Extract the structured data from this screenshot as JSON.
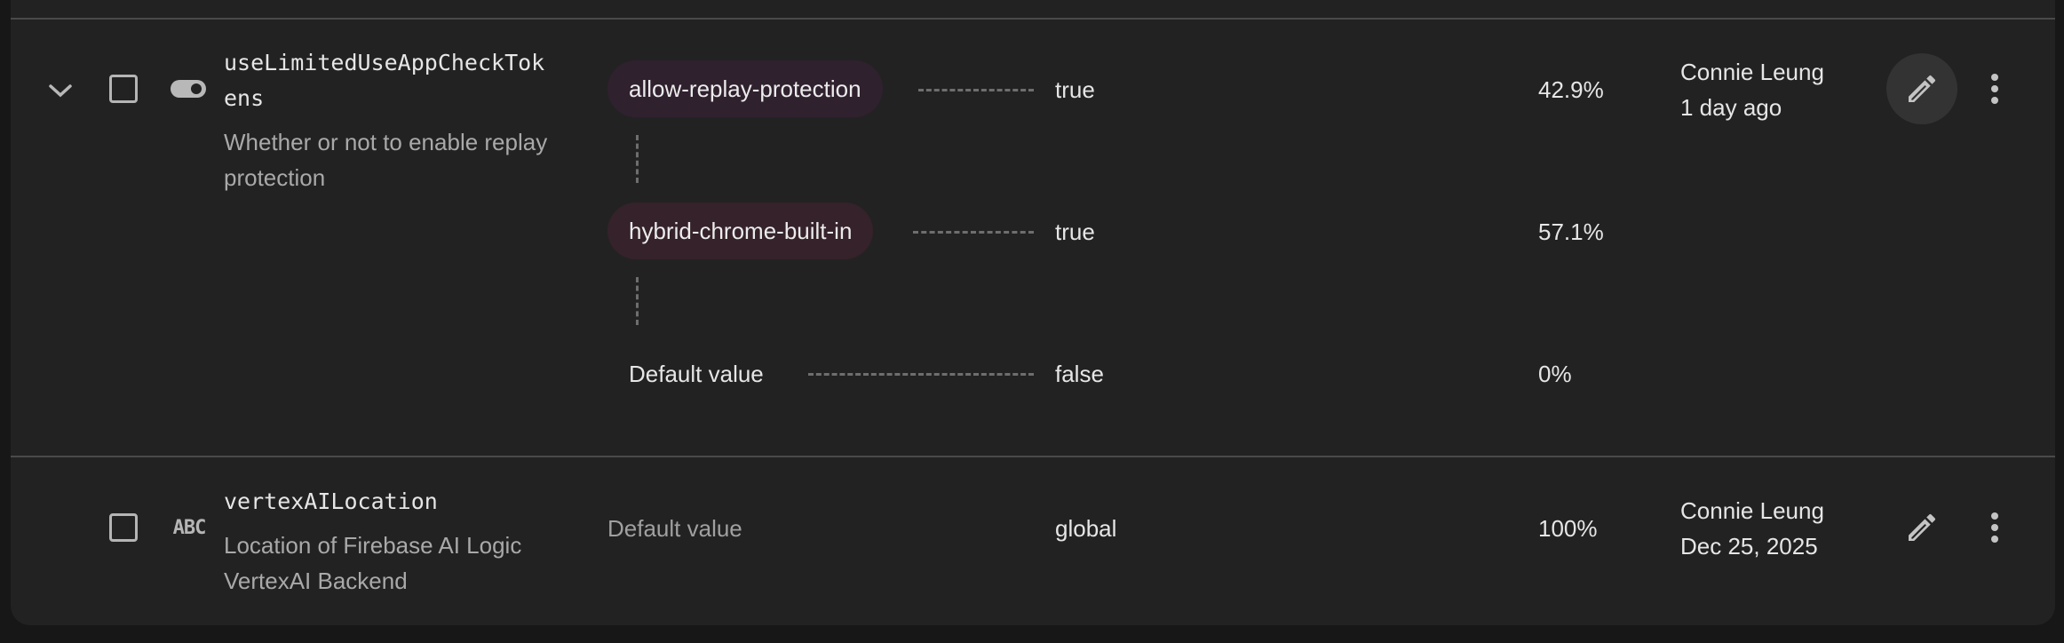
{
  "rows": [
    {
      "name": "useLimitedUseAppCheckTok",
      "name_cont": "ens",
      "description_1": "Whether or not to enable replay",
      "description_2": "protection",
      "conditions": [
        {
          "label": "allow-replay-protection",
          "value": "true",
          "percent": "42.9%",
          "chip_color": "#30212f"
        },
        {
          "label": "hybrid-chrome-built-in",
          "value": "true",
          "percent": "57.1%",
          "chip_color": "#35222a"
        },
        {
          "label": "Default value",
          "value": "false",
          "percent": "0%"
        }
      ],
      "updated_by": "Connie Leung",
      "updated_when": "1 day ago"
    },
    {
      "name": "vertexAILocation",
      "description_1": "Location of Firebase AI Logic",
      "description_2": "VertexAI Backend",
      "type_icon_label": "ABC",
      "default_label": "Default value",
      "value": "global",
      "percent": "100%",
      "updated_by": "Connie Leung",
      "updated_when": "Dec 25, 2025"
    }
  ],
  "icons": {
    "expand": "chevron-down-icon",
    "type_boolean": "toggle-icon",
    "type_string": "abc-icon",
    "edit": "pencil-icon",
    "more": "more-vertical-icon"
  }
}
